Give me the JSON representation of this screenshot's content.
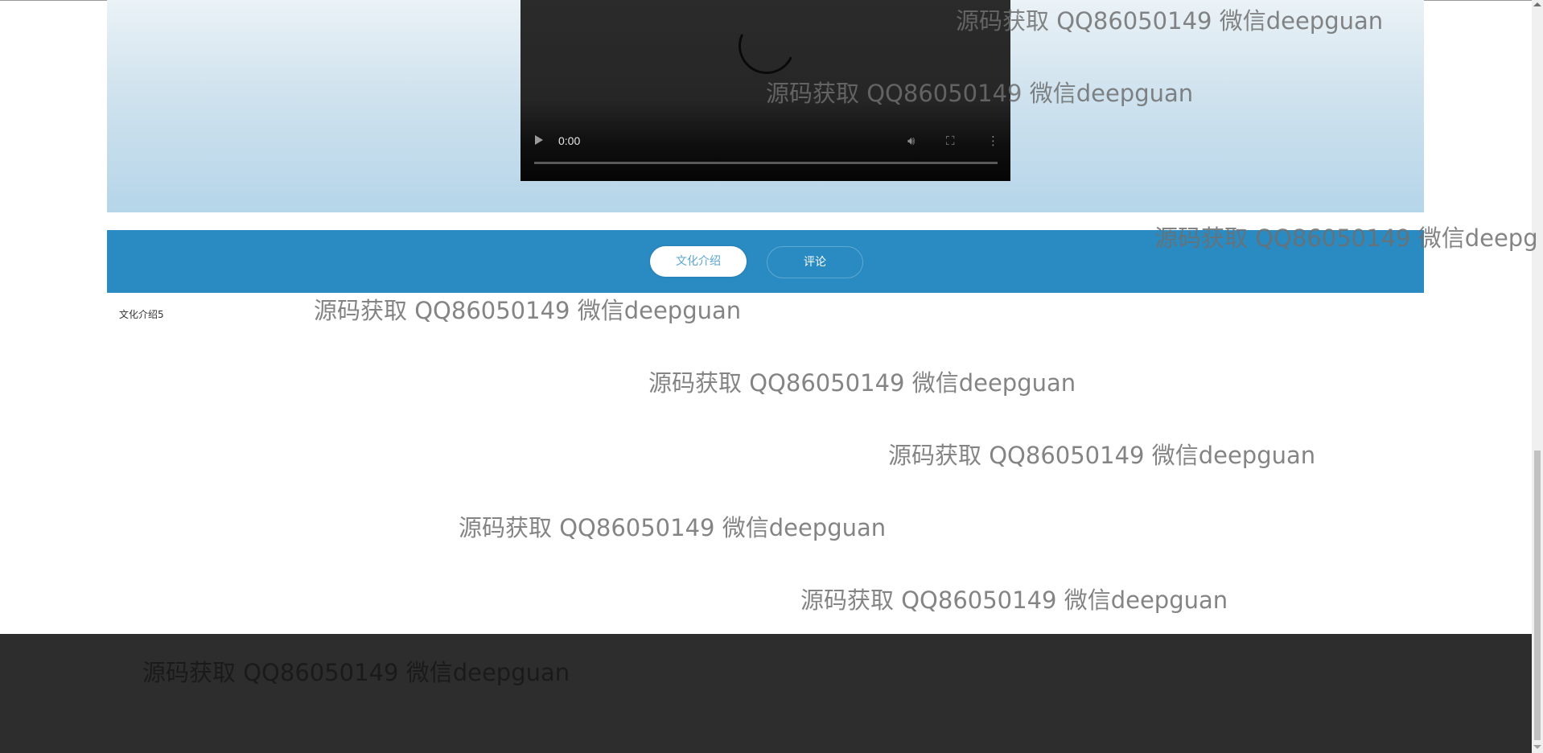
{
  "video": {
    "time": "0:00",
    "icons": {
      "play": "play-icon",
      "volume": "volume-icon",
      "fullscreen": "fullscreen-icon",
      "more": "more-options-icon",
      "loading": "loading-spinner-icon"
    }
  },
  "tabs": [
    {
      "label": "文化介绍",
      "active": true
    },
    {
      "label": "评论",
      "active": false
    }
  ],
  "content": {
    "text": "文化介绍5"
  },
  "watermark": {
    "text": "源码获取 QQ86050149 微信deepguan",
    "text_cut": "源码获取 QQ86050149 微信deepg"
  },
  "colors": {
    "tab_bar": "#2a8bc3",
    "footer": "#2d2d2d",
    "active_tab_text": "#5aa6d2"
  }
}
